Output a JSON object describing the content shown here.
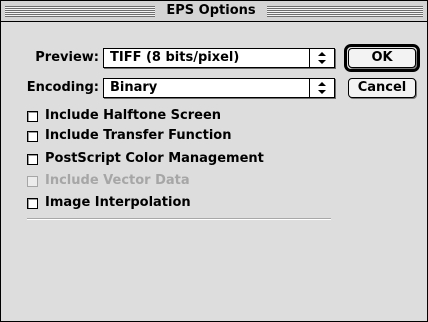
{
  "dialog": {
    "title": "EPS Options"
  },
  "preview": {
    "label": "Preview:",
    "selected": "TIFF (8 bits/pixel)",
    "arrows_icon": "popup-arrows-icon"
  },
  "encoding": {
    "label": "Encoding:",
    "selected": "Binary",
    "arrows_icon": "popup-arrows-icon"
  },
  "buttons": {
    "ok_label": "OK",
    "cancel_label": "Cancel"
  },
  "options": [
    {
      "label": "Include Halftone Screen",
      "checked": false,
      "enabled": true
    },
    {
      "label": "Include Transfer Function",
      "checked": false,
      "enabled": true
    },
    {
      "label": "PostScript Color Management",
      "checked": false,
      "enabled": true
    },
    {
      "label": "Include Vector Data",
      "checked": false,
      "enabled": false
    },
    {
      "label": "Image Interpolation",
      "checked": false,
      "enabled": true
    }
  ]
}
